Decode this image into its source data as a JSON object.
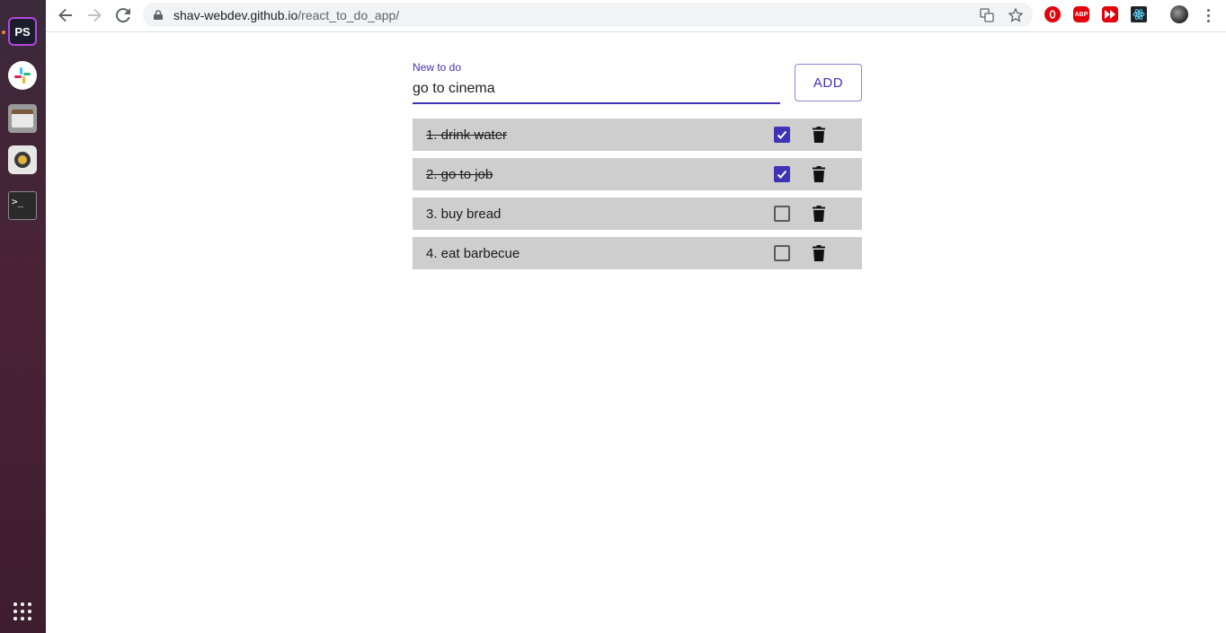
{
  "browser": {
    "url_host": "shav-webdev.github.io",
    "url_path": "/react_to_do_app/"
  },
  "dock": {
    "items": [
      "phpstorm-icon",
      "slack-icon",
      "files-icon",
      "rhythmbox-icon",
      "terminal-icon"
    ],
    "phpstorm_label": "PS",
    "terminal_label": ">_"
  },
  "todo": {
    "input_label": "New to do",
    "input_value": "go to cinema",
    "add_label": "ADD",
    "accent_color": "#3f33b5",
    "items": [
      {
        "text": "1. drink water",
        "done": true
      },
      {
        "text": "2. go to job",
        "done": true
      },
      {
        "text": "3. buy bread",
        "done": false
      },
      {
        "text": "4. eat barbecue",
        "done": false
      }
    ]
  }
}
